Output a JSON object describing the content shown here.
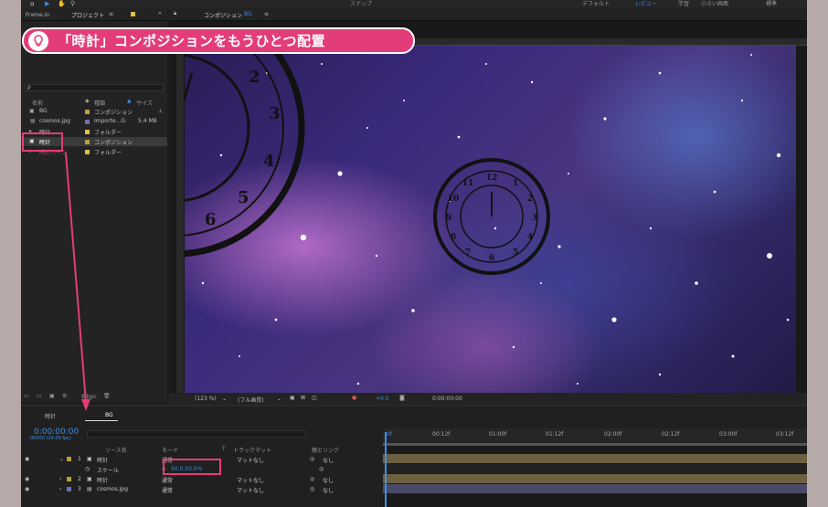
{
  "toolbar": {
    "workspaces": [
      "デフォルト",
      "レビュー",
      "学習",
      "小さい画面",
      "標準"
    ],
    "snap_label": "スナップ"
  },
  "tabs": {
    "frameio": "Frame.io",
    "project": "プロジェクト",
    "composition_prefix": "コンポジション",
    "composition_name": "BG"
  },
  "project": {
    "search_placeholder": "ρ",
    "columns": {
      "name": "名前",
      "type": "種類",
      "size": "サイズ"
    },
    "items": [
      {
        "name": "BG",
        "type": "コンポジション",
        "size": "",
        "color": "#b9a23a"
      },
      {
        "name": "cosmos.jpg",
        "type": "Importe...G",
        "size": "5.4 MB",
        "color": "#6f6fb0"
      },
      {
        "name": "時計",
        "type": "フォルダー",
        "size": "",
        "color": "#d8c24a"
      },
      {
        "name": "時計",
        "type": "コンポジション",
        "size": "",
        "color": "#b9a23a"
      },
      {
        "name": "時計パーツ",
        "type": "フォルダー",
        "size": "",
        "color": "#d8c24a"
      }
    ],
    "footer_bpc": "8 bpc"
  },
  "viewer_footer": {
    "zoom": "(123 %)",
    "resolution": "(フル画質)",
    "exposure": "+0.0",
    "time": "0:00:00:00"
  },
  "timeline": {
    "tab_clock": "時計",
    "tab_bg": "BG",
    "timecode": "0:00:00:00",
    "fps": "00000 (24.00 fps)",
    "columns": {
      "source": "ソース名",
      "mode": "モード",
      "t": "T",
      "trackmatte": "トラックマット",
      "parent": "親とリンク"
    },
    "layers": [
      {
        "num": "1",
        "name": "時計",
        "mode": "通常",
        "matte": "マットなし",
        "parent": "なし",
        "color": "#b9a23a"
      },
      {
        "num": "",
        "name": "スケール",
        "value": "50.0,50.0%",
        "is_property": true
      },
      {
        "num": "2",
        "name": "時計",
        "mode": "通常",
        "matte": "マットなし",
        "parent": "なし",
        "color": "#b9a23a"
      },
      {
        "num": "3",
        "name": "cosmos.jpg",
        "mode": "通常",
        "matte": "マットなし",
        "parent": "なし",
        "color": "#6f6fb0"
      }
    ],
    "ruler_labels": [
      "0f",
      "00:12f",
      "01:00f",
      "01:12f",
      "02:00f",
      "02:12f",
      "03:00f",
      "03:12f"
    ]
  },
  "callout": {
    "text": "「時計」コンポジションをもうひとつ配置"
  },
  "colors": {
    "accent_pink": "#e33d79",
    "accent_blue": "#3d8ee6"
  }
}
